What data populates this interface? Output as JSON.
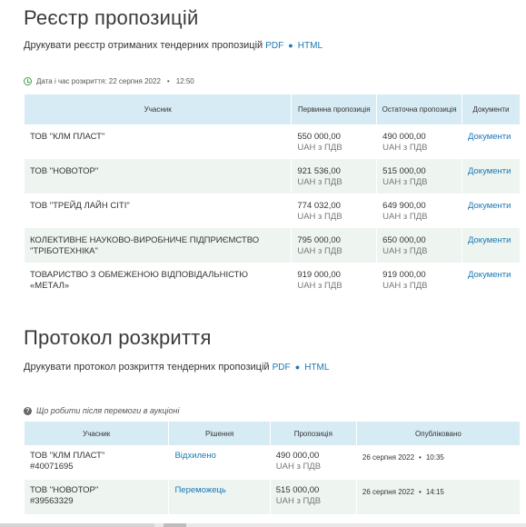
{
  "registry": {
    "title": "Реєстр пропозицій",
    "print_text": "Друкувати реєстр отриманих тендерних пропозицій",
    "pdf_label": "PDF",
    "separator": "●",
    "html_label": "HTML",
    "datetime_label": "Дата і час розкриття: 22 серпня 2022",
    "datetime_sep": "•",
    "datetime_time": "12:50",
    "headers": [
      "Учасник",
      "Первинна пропозиція",
      "Остаточна пропозиція",
      "Документи"
    ],
    "rows": [
      {
        "name": "ТОВ \"КЛМ ПЛАСТ\"",
        "initial": "550 000,00",
        "initial_sub": "UAH з ПДВ",
        "final": "490 000,00",
        "final_sub": "UAH з ПДВ",
        "docs": "Документи"
      },
      {
        "name": "ТОВ \"НОВОТОР\"",
        "initial": "921 536,00",
        "initial_sub": "UAH з ПДВ",
        "final": "515 000,00",
        "final_sub": "UAH з ПДВ",
        "docs": "Документи"
      },
      {
        "name": "ТОВ \"ТРЕЙД ЛАЙН СІТІ\"",
        "initial": "774 032,00",
        "initial_sub": "UAH з ПДВ",
        "final": "649 900,00",
        "final_sub": "UAH з ПДВ",
        "docs": "Документи"
      },
      {
        "name": "КОЛЕКТИВНЕ НАУКОВО-ВИРОБНИЧЕ ПІДПРИЄМСТВО \"ТРІБОТЕХНІКА\"",
        "initial": "795 000,00",
        "initial_sub": "UAH з ПДВ",
        "final": "650 000,00",
        "final_sub": "UAH з ПДВ",
        "docs": "Документи"
      },
      {
        "name": "ТОВАРИСТВО З ОБМЕЖЕНОЮ ВІДПОВІДАЛЬНІСТЮ «МЕТАЛ»",
        "initial": "919 000,00",
        "initial_sub": "UAH з ПДВ",
        "final": "919 000,00",
        "final_sub": "UAH з ПДВ",
        "docs": "Документи"
      }
    ]
  },
  "protocol": {
    "title": "Протокол розкриття",
    "print_text": "Друкувати протокол розкриття тендерних пропозицій",
    "pdf_label": "PDF",
    "separator": "●",
    "html_label": "HTML",
    "help_icon": "?",
    "help_text": "Що робити після перемоги в аукціоні",
    "headers": [
      "Учасник",
      "Рішення",
      "Пропозиція",
      "Опубліковано"
    ],
    "rows": [
      {
        "name": "ТОВ \"КЛМ ПЛАСТ\"",
        "code": "#40071695",
        "decision": "Відхилено",
        "offer": "490 000,00",
        "offer_sub": "UAH з ПДВ",
        "date": "26 серпня 2022",
        "sep": "•",
        "time": "10:35"
      },
      {
        "name": "ТОВ \"НОВОТОР\"",
        "code": "#39563329",
        "decision": "Переможець",
        "offer": "515 000,00",
        "offer_sub": "UAH з ПДВ",
        "date": "26 серпня 2022",
        "sep": "•",
        "time": "14:15"
      }
    ]
  },
  "colors": {
    "link": "#1a78b4",
    "header_bg": "#d6ebf4",
    "alt_row_bg": "#eef5f0",
    "clock": "#3aa34b"
  }
}
